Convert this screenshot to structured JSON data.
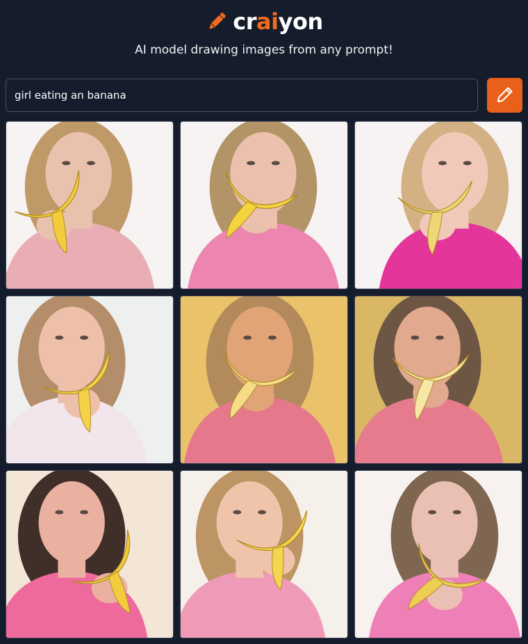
{
  "header": {
    "logo_text_before": "cr",
    "logo_text_ai": "ai",
    "logo_text_after": "yon",
    "logo_icon": "pencil-icon",
    "tagline": "AI model drawing images from any prompt!"
  },
  "search": {
    "value": "girl eating an banana",
    "draw_button_icon": "pencil-icon"
  },
  "colors": {
    "background": "#151c2c",
    "accent": "#e9601a",
    "logo_ai": "#f26b1d"
  },
  "results": {
    "images": [
      {
        "bg": "#f6f3f2",
        "shirt": "#e9aeb4",
        "hair": "#c09968",
        "skin": "#e9c2ae",
        "fruit": "#f2cc3a"
      },
      {
        "bg": "#f6f3f2",
        "shirt": "#ec86b0",
        "hair": "#b29467",
        "skin": "#ebc1ae",
        "fruit": "#f4d43e"
      },
      {
        "bg": "#f6f3f2",
        "shirt": "#e4359b",
        "hair": "#d3b184",
        "skin": "#f0c9b8",
        "fruit": "#f0d776"
      },
      {
        "bg": "#eef0f0",
        "shirt": "#f2e6ec",
        "hair": "#b48d6b",
        "skin": "#eec0aa",
        "fruit": "#f3d24a"
      },
      {
        "bg": "#e9c26a",
        "shirt": "#e6788b",
        "hair": "#b28a5b",
        "skin": "#e0a477",
        "fruit": "#f6dc87"
      },
      {
        "bg": "#d9b765",
        "shirt": "#e67b8e",
        "hair": "#6e5644",
        "skin": "#e1a98e",
        "fruit": "#f6e7a6"
      },
      {
        "bg": "#f3e6d6",
        "shirt": "#ee6a9c",
        "hair": "#3f2f28",
        "skin": "#eab1a1",
        "fruit": "#f2cc3e"
      },
      {
        "bg": "#f6f0ea",
        "shirt": "#ef9bb8",
        "hair": "#bd9464",
        "skin": "#f0c3ab",
        "fruit": "#f5d54d"
      },
      {
        "bg": "#f7f2ef",
        "shirt": "#ef7fb7",
        "hair": "#7e6650",
        "skin": "#ebc0b4",
        "fruit": "#efcf53"
      }
    ]
  }
}
